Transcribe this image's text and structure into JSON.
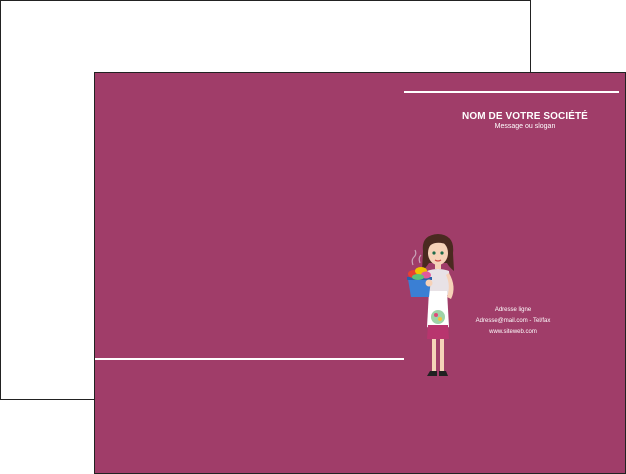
{
  "colors": {
    "brand": "#a03d69",
    "line": "#ffffff"
  },
  "header": {
    "company_name": "NOM DE VOTRE SOCIÉTÉ",
    "slogan": "Message ou slogan"
  },
  "contact": {
    "address": "Adresse ligne",
    "email_phone": "Adresse@mail.com - Tel/fax",
    "website": "www.siteweb.com"
  },
  "illustration": {
    "icon": "woman-with-laundry-basket-icon"
  }
}
